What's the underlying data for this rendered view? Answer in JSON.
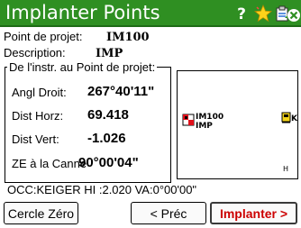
{
  "titlebar": {
    "title": "Implanter Points",
    "icons": [
      "help-icon",
      "favorite-star-icon",
      "clipboard-icon",
      "close-icon"
    ]
  },
  "fields": {
    "point_label": "Point de projet:",
    "point_value": "IM100",
    "desc_label": "Description:",
    "desc_value": "IMP"
  },
  "group": {
    "title": "De l'instr. au Point de projet:",
    "rows": [
      {
        "label": "Angl Droit:",
        "value": "267°40'11\""
      },
      {
        "label": "Dist Horz:",
        "value": "69.418"
      },
      {
        "label": "Dist Vert:",
        "value": "-1.026"
      },
      {
        "label": "ZE à la Canne",
        "value": "90°00'04\""
      }
    ]
  },
  "map": {
    "point_name": "IM100",
    "point_desc": "IMP",
    "station_label": "K",
    "h_label": "H"
  },
  "status": {
    "text": "OCC:KEIGER  HI :2.020  VA:0°00'00\""
  },
  "buttons": {
    "zero": "Cercle Zéro",
    "prev": "< Préc",
    "stake": "Implanter >"
  },
  "colors": {
    "titlebar": "#2f8f22",
    "stake_text": "#cc0000"
  }
}
